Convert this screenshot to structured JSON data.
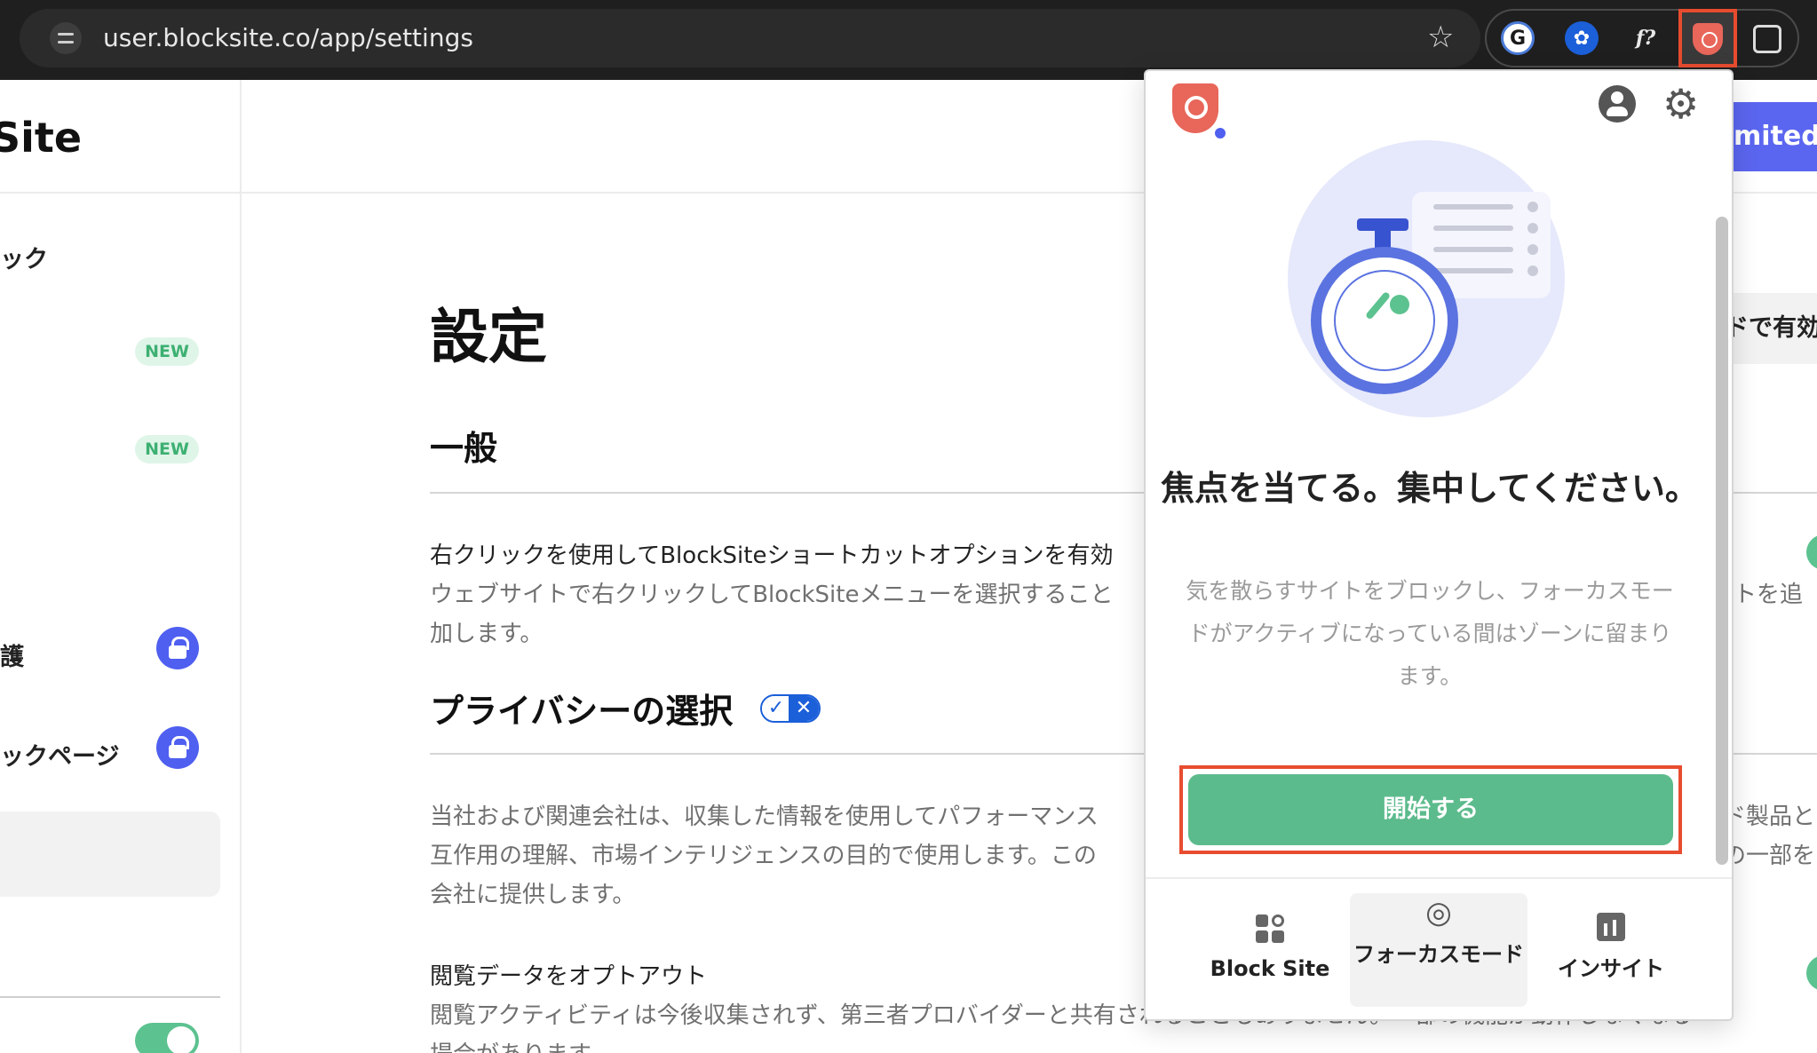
{
  "browser": {
    "url": "user.blocksite.co/app/settings",
    "bookmark_icon": "star-icon",
    "extensions": [
      {
        "name": "extension-1-icon",
        "glyph": "G"
      },
      {
        "name": "extension-2-icon",
        "glyph": "✿"
      },
      {
        "name": "extension-3-icon",
        "glyph": "f?"
      },
      {
        "name": "blocksite-extension-icon",
        "glyph": ""
      },
      {
        "name": "extensions-puzzle-icon",
        "glyph": ""
      }
    ]
  },
  "sidebar": {
    "logo": "Site",
    "items": [
      {
        "label": "ック"
      },
      {
        "badge": "NEW"
      },
      {
        "badge": "NEW"
      },
      {
        "label": "護"
      },
      {
        "label": "ックページ"
      }
    ]
  },
  "header": {
    "upgrade_label": "mited",
    "right_chip": "ドで有効"
  },
  "main": {
    "title": "設定",
    "general_heading": "一般",
    "context_menu_title": "右クリックを使用してBlockSiteショートカットオプションを有効",
    "context_menu_desc_1": "ウェブサイトで右クリックしてBlockSiteメニューを選択すること",
    "context_menu_desc_2": "加します。",
    "context_menu_right": "トを追",
    "privacy_heading": "プライバシーの選択",
    "privacy_desc_1": "当社および関連会社は、収集した情報を使用してパフォーマンス",
    "privacy_desc_2": "互作用の理解、市場インテリジェンスの目的で使用します。この",
    "privacy_desc_3": "会社に提供します。",
    "privacy_right_1": "ド製品と",
    "privacy_right_2": "の一部を",
    "optout_title": "閲覧データをオプトアウト",
    "optout_desc_1": "閲覧アクティビティは今後収集されず、第三者プロバイダーと共有されることもありません。一部の機能が動作しなくなる",
    "optout_desc_2": "場合があります。"
  },
  "popup": {
    "title": "焦点を当てる。集中してください。",
    "description": "気を散らすサイトをブロックし、フォーカスモードがアクティブになっている間はゾーンに留まります。",
    "start_label": "開始する",
    "tabs": [
      {
        "label": "Block Site"
      },
      {
        "label": "フォーカスモード"
      },
      {
        "label": "インサイト"
      }
    ]
  },
  "colors": {
    "accent_green": "#5cbb8c",
    "accent_blue": "#5b66f0",
    "highlight_red": "#e84c2f"
  }
}
